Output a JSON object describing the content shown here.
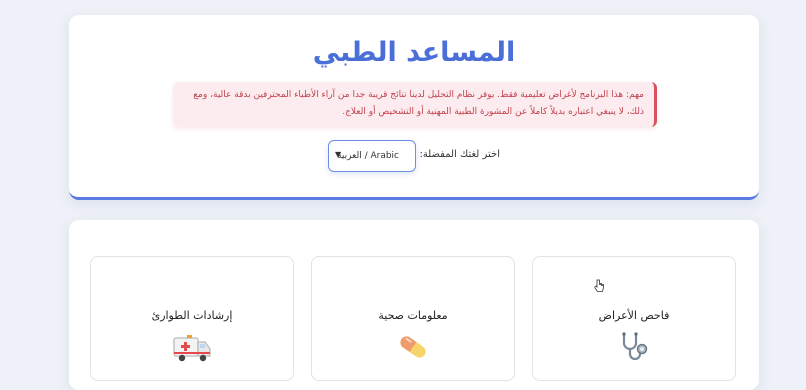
{
  "header": {
    "title": "المساعد الطبي",
    "warning_line1": "مهم: هذا البرنامج لأغراض تعليمية فقط. يوفر نظام التحليل لدينا نتائج قريبة جدا من آراء الأطباء المحترفين بدقة عالية، ومع",
    "warning_line2": "ذلك، لا ينبغي اعتباره بديلاً كاملاً عن المشورة الطبية المهنية أو التشخيص أو العلاج."
  },
  "language": {
    "label": "اختر لغتك المفضلة:",
    "selected": "العربية / Arabic"
  },
  "tiles": [
    {
      "label": "إرشادات الطوارئ",
      "icon": "ambulance-icon"
    },
    {
      "label": "معلومات صحية",
      "icon": "pill-icon"
    },
    {
      "label": "فاحص الأعراض",
      "icon": "stethoscope-icon"
    }
  ],
  "colors": {
    "accent": "#4a6fd8",
    "warning_text": "#c0424e",
    "warning_bg": "#fdecef"
  }
}
